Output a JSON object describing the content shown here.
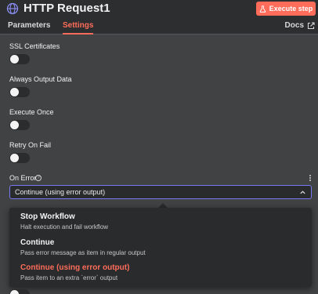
{
  "header": {
    "title": "HTTP Request1",
    "node_icon": "globe-icon",
    "execute_label": "Execute step",
    "execute_icon": "flask-icon"
  },
  "tabs": [
    {
      "label": "Parameters",
      "active": false
    },
    {
      "label": "Settings",
      "active": true
    }
  ],
  "docs_label": "Docs",
  "settings": [
    {
      "label": "SSL Certificates",
      "enabled": false
    },
    {
      "label": "Always Output Data",
      "enabled": false
    },
    {
      "label": "Execute Once",
      "enabled": false
    },
    {
      "label": "Retry On Fail",
      "enabled": false
    }
  ],
  "on_error": {
    "label": "On Error",
    "help_icon": "question-circle-icon",
    "selected_value": "Continue (using error output)",
    "options": [
      {
        "title": "Stop Workflow",
        "description": "Halt execution and fail workflow",
        "selected": false
      },
      {
        "title": "Continue",
        "description": "Pass error message as item in regular output",
        "selected": false
      },
      {
        "title": "Continue (using error output)",
        "description": "Pass item to an extra `error` output",
        "selected": true
      }
    ]
  },
  "colors": {
    "accent": "#ff6d5a",
    "focus_border": "#7a78f0",
    "panel_bg": "#414244",
    "header_bg": "#2d2e30"
  }
}
